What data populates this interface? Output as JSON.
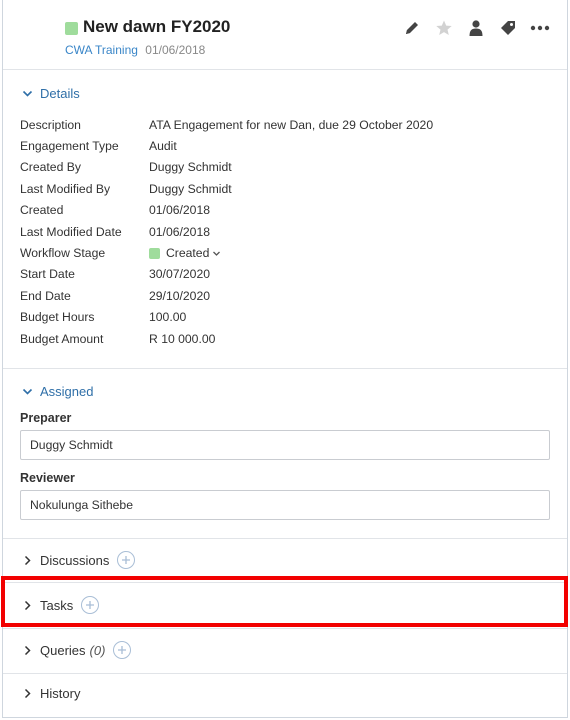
{
  "header": {
    "title": "New dawn FY2020",
    "client": "CWA Training",
    "date": "01/06/2018",
    "status_color": "#9fdc9c",
    "toolbar_icons": [
      "pencil-icon",
      "star-icon",
      "user-icon",
      "tag-icon",
      "more-icon"
    ]
  },
  "details": {
    "heading": "Details",
    "rows": [
      {
        "label": "Description",
        "value": "ATA Engagement for new Dan, due 29 October 2020"
      },
      {
        "label": "Engagement Type",
        "value": "Audit"
      },
      {
        "label": "Created By",
        "value": "Duggy Schmidt"
      },
      {
        "label": "Last Modified By",
        "value": "Duggy Schmidt"
      },
      {
        "label": "Created",
        "value": "01/06/2018"
      },
      {
        "label": "Last Modified Date",
        "value": "01/06/2018"
      },
      {
        "label": "Workflow Stage",
        "value": "Created"
      },
      {
        "label": "Start Date",
        "value": "30/07/2020"
      },
      {
        "label": "End Date",
        "value": "29/10/2020"
      },
      {
        "label": "Budget Hours",
        "value": "100.00"
      },
      {
        "label": "Budget Amount",
        "value": "R 10 000.00"
      }
    ]
  },
  "assigned": {
    "heading": "Assigned",
    "preparer_label": "Preparer",
    "preparer_value": "Duggy Schmidt",
    "reviewer_label": "Reviewer",
    "reviewer_value": "Nokulunga Sithebe"
  },
  "sections": {
    "discussions": "Discussions",
    "tasks": "Tasks",
    "queries": "Queries",
    "queries_count": "(0)",
    "history": "History"
  },
  "colors": {
    "accent": "#2f6fa8",
    "link": "#3a86c8",
    "highlight": "#f20000"
  }
}
